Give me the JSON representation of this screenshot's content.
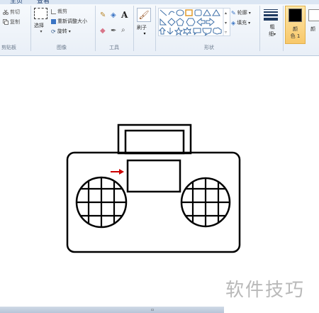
{
  "tabs": [
    {
      "label": "主页"
    },
    {
      "label": "查看"
    }
  ],
  "clipboard": {
    "cut": "剪切",
    "copy": "复制",
    "label": "剪贴板"
  },
  "image": {
    "select": "选择",
    "crop": "裁剪",
    "resize": "重新调整大小",
    "rotate": "旋转",
    "label": "图像"
  },
  "tools": {
    "label": "工具"
  },
  "brush": {
    "label": "刷子"
  },
  "shapes": {
    "outline": "轮廓",
    "fill": "填充",
    "label": "形状"
  },
  "size": {
    "label_1": "粗",
    "label_2": "细"
  },
  "colors": {
    "color1_label_1": "颜",
    "color1_label_2": "色 1",
    "color2_label": "颜",
    "color1": "#000000",
    "color2": "#ffffff"
  },
  "canvas": {
    "arrow_color": "#cc0000"
  },
  "watermark": "软件技巧"
}
